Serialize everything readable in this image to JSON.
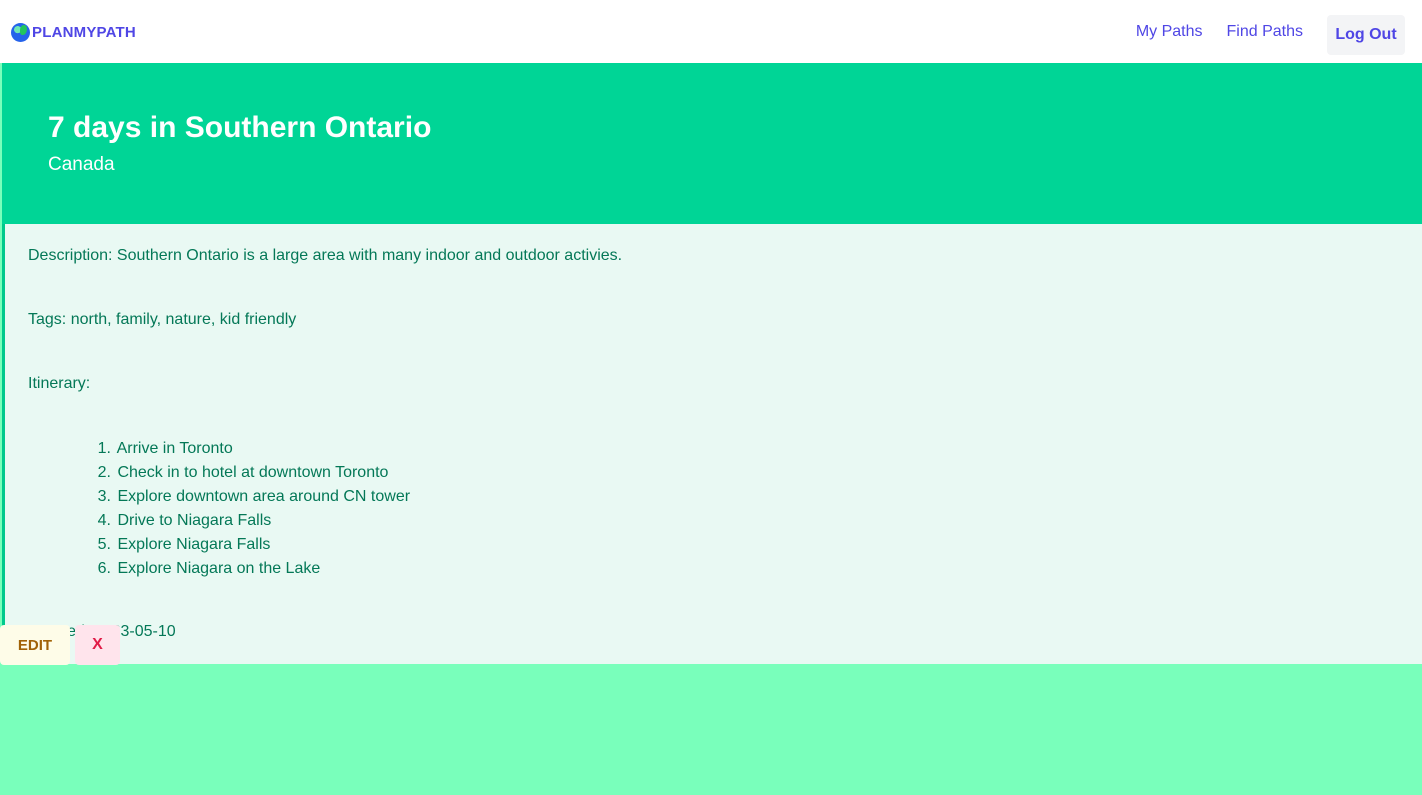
{
  "nav": {
    "brand": "PLANMYPATH",
    "brand_icon": "globe-icon",
    "links": [
      "My Paths",
      "Find Paths"
    ],
    "logout_label": "Log Out"
  },
  "path": {
    "title": "7 days in Southern Ontario",
    "country": "Canada",
    "description": "Description: Southern Ontario is a large area with many indoor and outdoor activies.",
    "tags": "Tags: north, family, nature, kid friendly",
    "itinerary_label": "Itinerary:",
    "itinerary": [
      "Arrive in Toronto",
      "Check in to hotel at downtown Toronto",
      "Explore downtown area around CN tower",
      "Drive to Niagara Falls",
      "Explore Niagara Falls",
      "Explore Niagara on the Lake"
    ],
    "created": "Created: 2023-05-10"
  },
  "actions": {
    "edit_label": "EDIT",
    "delete_label": "X"
  },
  "colors": {
    "accent": "#4f46e5",
    "hero": "#00d596",
    "page_bg": "#79ffbb",
    "text_green": "#047857"
  }
}
